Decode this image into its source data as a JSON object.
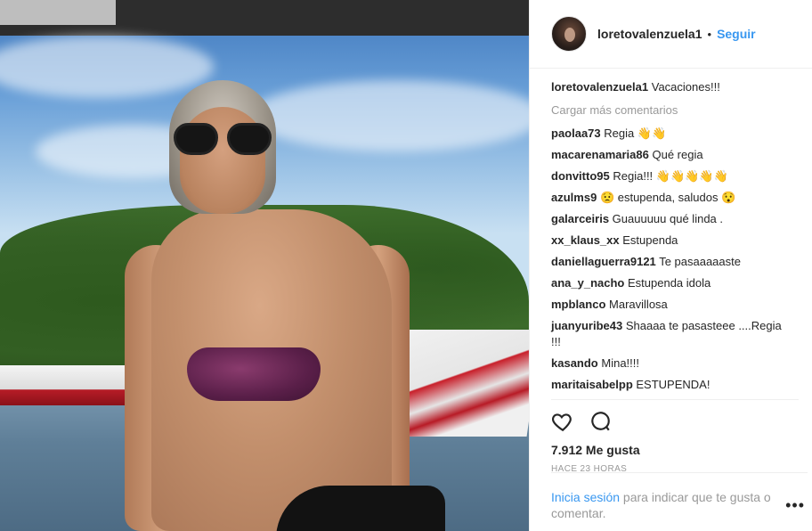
{
  "post": {
    "username": "loretovalenzuela1",
    "separator": "•",
    "follow_label": "Seguir",
    "caption_user": "loretovalenzuela1",
    "caption_text": "Vacaciones!!!",
    "load_more": "Cargar más comentarios",
    "comments": [
      {
        "user": "paolaa73",
        "text": "Regia 👋👋"
      },
      {
        "user": "macarenamaria86",
        "text": "Qué regia"
      },
      {
        "user": "donvitto95",
        "text": "Regia!!! 👋👋👋👋👋"
      },
      {
        "user": "azulms9",
        "text": "😟 estupenda, saludos 😯"
      },
      {
        "user": "galarceiris",
        "text": "Guauuuuu qué linda ."
      },
      {
        "user": "xx_klaus_xx",
        "text": "Estupenda"
      },
      {
        "user": "daniellaguerra9121",
        "text": "Te pasaaaaaste"
      },
      {
        "user": "ana_y_nacho",
        "text": "Estupenda idola"
      },
      {
        "user": "mpblanco",
        "text": "Maravillosa"
      },
      {
        "user": "juanyuribe43",
        "text": "Shaaaa te pasasteee ....Regia !!!"
      },
      {
        "user": "kasando",
        "text": "Mina!!!!"
      },
      {
        "user": "maritaisabelpp",
        "text": "ESTUPENDA!"
      }
    ],
    "likes": "7.912 Me gusta",
    "time_ago": "HACE 23 HORAS",
    "login_link": "Inicia sesión",
    "login_text": " para indicar que te gusta o comentar.",
    "more_label": "•••"
  },
  "icons": {
    "heart": "heart-icon",
    "comment": "comment-icon"
  },
  "colors": {
    "link_blue": "#3897f0",
    "text": "#262626",
    "muted": "#999999"
  }
}
